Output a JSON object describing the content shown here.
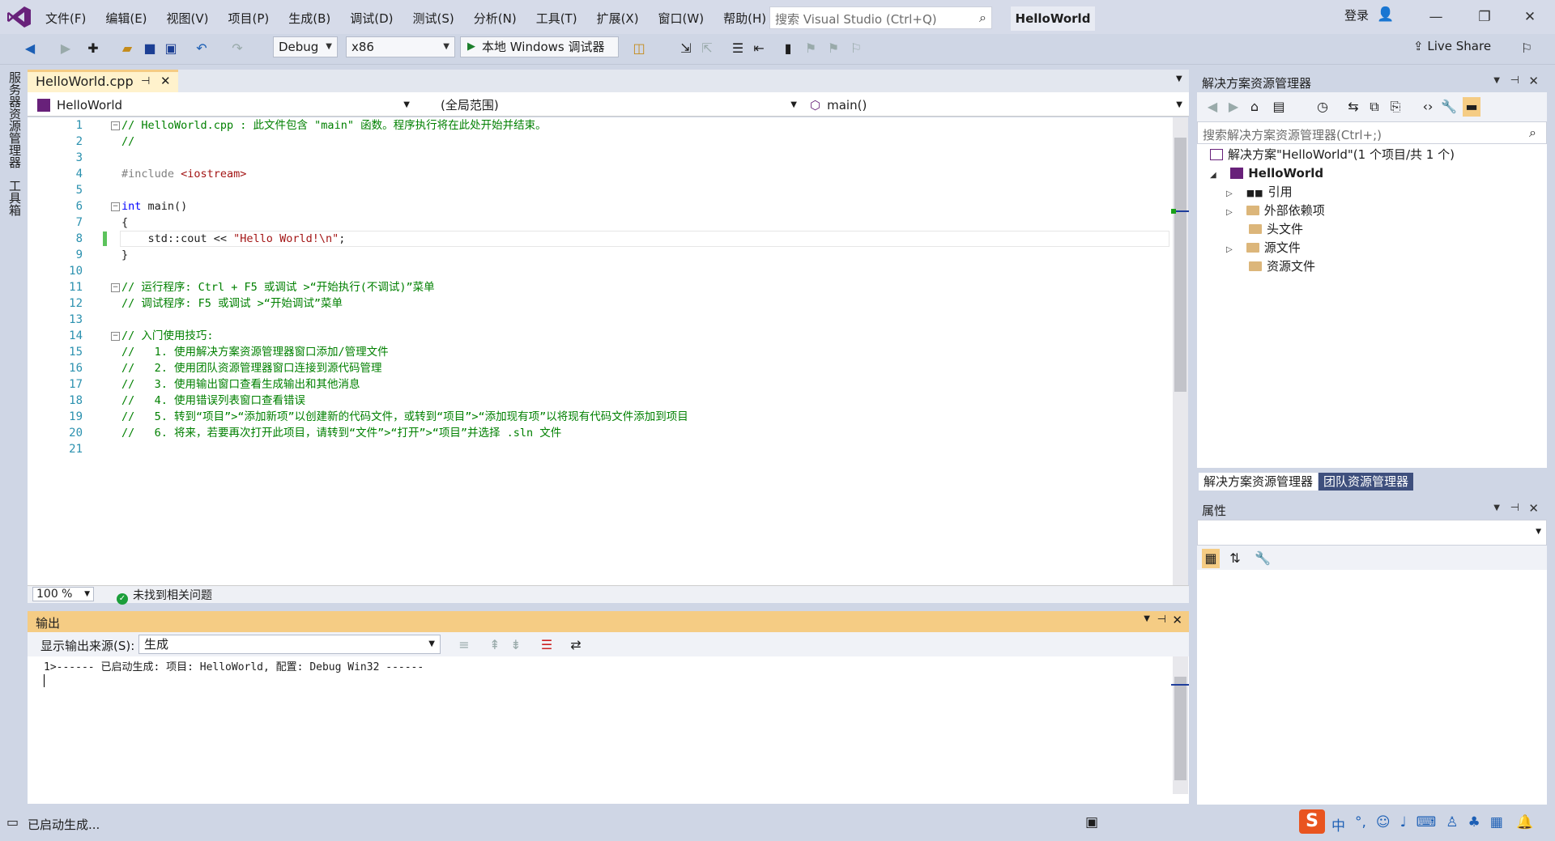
{
  "menu": [
    "文件(F)",
    "编辑(E)",
    "视图(V)",
    "项目(P)",
    "生成(B)",
    "调试(D)",
    "测试(S)",
    "分析(N)",
    "工具(T)",
    "扩展(X)",
    "窗口(W)",
    "帮助(H)"
  ],
  "search": {
    "placeholder": "搜索 Visual Studio (Ctrl+Q)"
  },
  "solution_title": "HelloWorld",
  "signin": "登录",
  "toolbar": {
    "config": "Debug",
    "platform": "x86",
    "start": "本地 Windows 调试器",
    "live_share": "Live Share"
  },
  "side_tabs": [
    "服务器资源管理器",
    "工具箱"
  ],
  "editor": {
    "tab": "HelloWorld.cpp",
    "nav_project": "HelloWorld",
    "nav_scope": "(全局范围)",
    "nav_member": "main()",
    "lines": [
      {
        "n": "1"
      },
      {
        "n": "2"
      },
      {
        "n": "3"
      },
      {
        "n": "4"
      },
      {
        "n": "5"
      },
      {
        "n": "6"
      },
      {
        "n": "7"
      },
      {
        "n": "8"
      },
      {
        "n": "9"
      },
      {
        "n": "10"
      },
      {
        "n": "11"
      },
      {
        "n": "12"
      },
      {
        "n": "13"
      },
      {
        "n": "14"
      },
      {
        "n": "15"
      },
      {
        "n": "16"
      },
      {
        "n": "17"
      },
      {
        "n": "18"
      },
      {
        "n": "19"
      },
      {
        "n": "20"
      },
      {
        "n": "21"
      }
    ],
    "code": {
      "l1": "// HelloWorld.cpp : 此文件包含 \"main\" 函数。程序执行将在此处开始并结束。",
      "l2": "//",
      "l4a": "#include ",
      "l4b": "<iostream>",
      "l6a": "int",
      "l6b": " main()",
      "l7": "{",
      "l8a": "    std::cout << ",
      "l8b": "\"Hello World!\\n\"",
      "l8c": ";",
      "l9": "}",
      "l11": "// 运行程序: Ctrl + F5 或调试 >“开始执行(不调试)”菜单",
      "l12": "// 调试程序: F5 或调试 >“开始调试”菜单",
      "l14": "// 入门使用技巧:",
      "l15": "//   1. 使用解决方案资源管理器窗口添加/管理文件",
      "l16": "//   2. 使用团队资源管理器窗口连接到源代码管理",
      "l17": "//   3. 使用输出窗口查看生成输出和其他消息",
      "l18": "//   4. 使用错误列表窗口查看错误",
      "l19": "//   5. 转到“项目”>“添加新项”以创建新的代码文件，或转到“项目”>“添加现有项”以将现有代码文件添加到项目",
      "l20": "//   6. 将来，若要再次打开此项目，请转到“文件”>“打开”>“项目”并选择 .sln 文件"
    },
    "zoom": "100 %",
    "issues": "未找到相关问题"
  },
  "output": {
    "title": "输出",
    "source_label": "显示输出来源(S):",
    "source_value": "生成",
    "text": "1>------ 已启动生成: 项目: HelloWorld, 配置: Debug Win32 ------"
  },
  "solution_explorer": {
    "title": "解决方案资源管理器",
    "search_placeholder": "搜索解决方案资源管理器(Ctrl+;)",
    "solution": "解决方案\"HelloWorld\"(1 个项目/共 1 个)",
    "project": "HelloWorld",
    "items": [
      "引用",
      "外部依赖项",
      "头文件",
      "源文件",
      "资源文件"
    ],
    "tabs": [
      "解决方案资源管理器",
      "团队资源管理器"
    ]
  },
  "properties": {
    "title": "属性"
  },
  "status": {
    "text": "已启动生成..."
  },
  "colors": {
    "accent": "#68217a",
    "active_tab": "#fff2cc",
    "output_header": "#f5cc84",
    "comment": "#008000",
    "keyword": "#0000ff",
    "string": "#a31515"
  }
}
